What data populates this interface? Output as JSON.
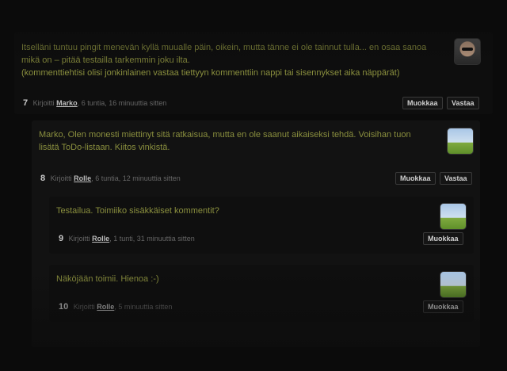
{
  "comments": [
    {
      "text_lines": [
        "Itselläni tuntuu pingit menevän kyllä muualle päin, oikein, mutta tänne ei ole tainnut tulla... en osaa sanoa",
        "mikä on – pitää testailla tarkemmin joku ilta.",
        "(kommenttiehtisi olisi jonkinlainen vastaa tiettyyn kommenttiin nappi tai sisennykset aika näppärät)"
      ],
      "number": "7",
      "written_by": "Kirjoitti",
      "author": "Marko",
      "time": ", 6 tuntia, 16 minuuttia sitten",
      "edit_label": "Muokkaa",
      "reply_label": "Vastaa",
      "avatar_icon": "user-photo-icon"
    },
    {
      "text_lines": [
        "Marko, Olen monesti miettinyt sitä ratkaisua, mutta en ole saanut aikaiseksi tehdä. Voisihan tuon",
        "lisätä ToDo-listaan. Kiitos vinkistä."
      ],
      "number": "8",
      "written_by": "Kirjoitti",
      "author": "Rolle",
      "time": ", 6 tuntia, 12 minuuttia sitten",
      "edit_label": "Muokkaa",
      "reply_label": "Vastaa",
      "avatar_icon": "landscape-avatar-icon"
    },
    {
      "text_lines": [
        "Testailua. Toimiiko sisäkkäiset kommentit?"
      ],
      "number": "9",
      "written_by": "Kirjoitti",
      "author": "Rolle",
      "time": ", 1 tunti, 31 minuuttia sitten",
      "edit_label": "Muokkaa",
      "avatar_icon": "landscape-avatar-icon"
    },
    {
      "text_lines": [
        "Näköjään toimii. Hienoa :-)"
      ],
      "number": "10",
      "written_by": "Kirjoitti",
      "author": "Rolle",
      "time": ", 5 minuuttia sitten",
      "edit_label": "Muokkaa",
      "avatar_icon": "landscape-avatar-icon"
    }
  ],
  "colors": {
    "background": "#0b0b0b",
    "comment_text": "#8a8f3e",
    "panel": "#121212"
  }
}
